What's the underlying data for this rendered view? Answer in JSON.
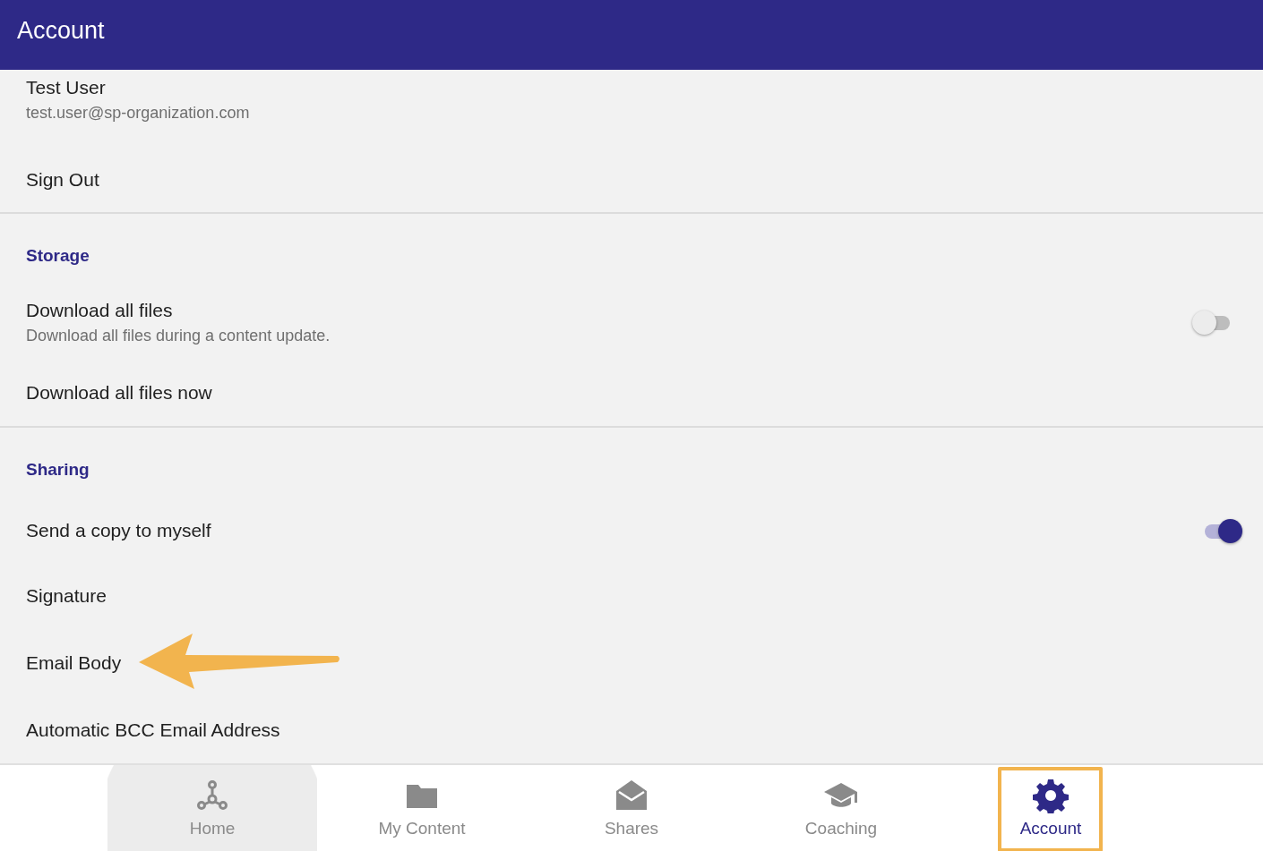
{
  "header": {
    "title": "Account"
  },
  "sections": [
    {
      "items": [
        {
          "kind": "profile",
          "title": "Test User",
          "subtitle": "test.user@sp-organization.com"
        },
        {
          "kind": "action",
          "title": "Sign Out"
        }
      ]
    },
    {
      "heading": "Storage",
      "items": [
        {
          "kind": "toggle",
          "title": "Download all files",
          "subtitle": "Download all files during a content update.",
          "on": false
        },
        {
          "kind": "action",
          "title": "Download all files now"
        }
      ]
    },
    {
      "heading": "Sharing",
      "items": [
        {
          "kind": "toggle",
          "title": "Send a copy to myself",
          "on": true
        },
        {
          "kind": "action",
          "title": "Signature"
        },
        {
          "kind": "action",
          "title": "Email Body",
          "annotated": true
        },
        {
          "kind": "action",
          "title": "Automatic BCC Email Address"
        }
      ]
    }
  ],
  "nav": [
    {
      "label": "Home",
      "selected": false,
      "pressed": true,
      "highlighted": false
    },
    {
      "label": "My Content",
      "selected": false,
      "pressed": false,
      "highlighted": false
    },
    {
      "label": "Shares",
      "selected": false,
      "pressed": false,
      "highlighted": false
    },
    {
      "label": "Coaching",
      "selected": false,
      "pressed": false,
      "highlighted": false
    },
    {
      "label": "Account",
      "selected": true,
      "pressed": false,
      "highlighted": true
    }
  ]
}
